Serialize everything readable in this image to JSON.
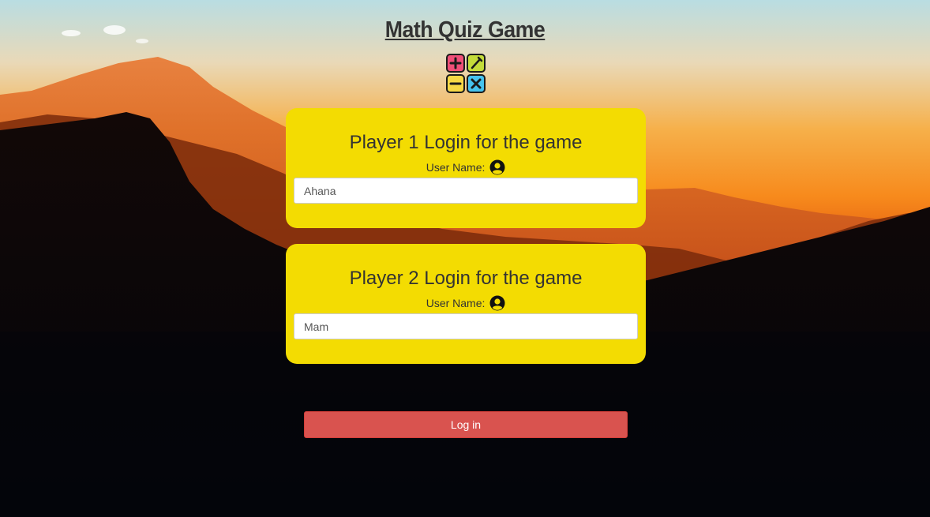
{
  "page": {
    "title": "Math Quiz Game"
  },
  "logo": {
    "icon": "math-operations-icon",
    "colors": [
      "#ef4f78",
      "#c4dc3a",
      "#f6d845",
      "#46c3ee"
    ]
  },
  "players": [
    {
      "heading": "Player 1 Login for the game",
      "label": "User Name:",
      "icon": "user-icon",
      "value": "Ahana"
    },
    {
      "heading": "Player 2 Login for the game",
      "label": "User Name:",
      "icon": "user-icon",
      "value": "Mam"
    }
  ],
  "actions": {
    "login_label": "Log in"
  },
  "colors": {
    "card": "#f3dc02",
    "button": "#d9534f",
    "title": "#333333"
  }
}
